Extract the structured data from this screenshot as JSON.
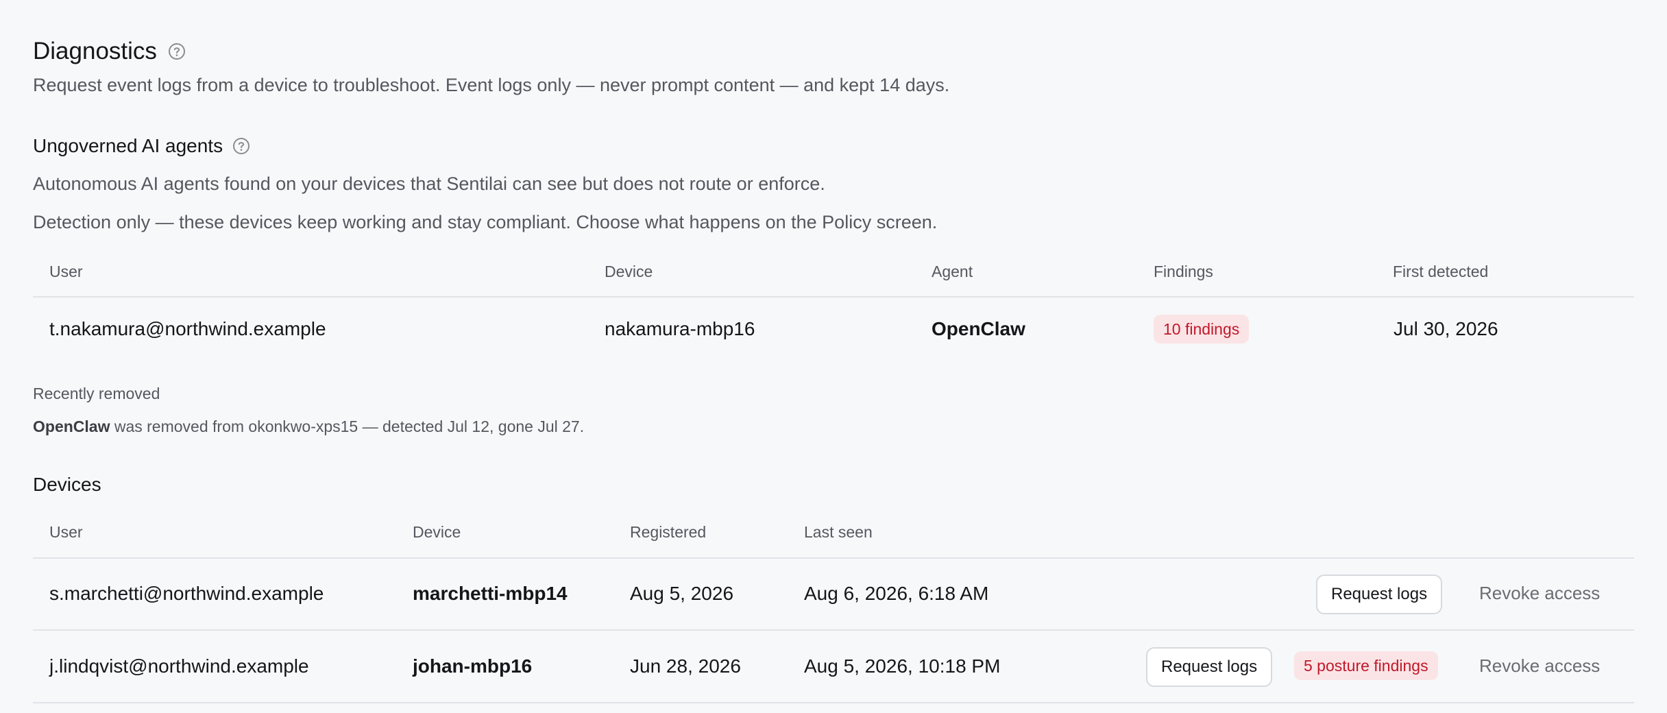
{
  "diagnostics": {
    "title": "Diagnostics",
    "subtitle": "Request event logs from a device to troubleshoot. Event logs only — never prompt content — and kept 14 days."
  },
  "ungoverned": {
    "title": "Ungoverned AI agents",
    "description1": "Autonomous AI agents found on your devices that Sentilai can see but does not route or enforce.",
    "description2": "Detection only — these devices keep working and stay compliant. Choose what happens on the Policy screen.",
    "columns": {
      "user": "User",
      "device": "Device",
      "agent": "Agent",
      "findings": "Findings",
      "first_detected": "First detected"
    },
    "rows": [
      {
        "user": "t.nakamura@northwind.example",
        "device": "nakamura-mbp16",
        "agent": "OpenClaw",
        "findings": "10 findings",
        "first_detected": "Jul 30, 2026"
      }
    ],
    "recently_removed": {
      "label": "Recently removed",
      "agent": "OpenClaw",
      "text": " was removed from okonkwo-xps15 — detected Jul 12, gone Jul 27."
    }
  },
  "devices": {
    "title": "Devices",
    "columns": {
      "user": "User",
      "device": "Device",
      "registered": "Registered",
      "last_seen": "Last seen"
    },
    "rows": [
      {
        "user": "s.marchetti@northwind.example",
        "device": "marchetti-mbp14",
        "registered": "Aug 5, 2026",
        "last_seen": "Aug 6, 2026, 6:18 AM",
        "request_logs": "Request logs",
        "revoke": "Revoke access"
      },
      {
        "user": "j.lindqvist@northwind.example",
        "device": "johan-mbp16",
        "registered": "Jun 28, 2026",
        "last_seen": "Aug 5, 2026, 10:18 PM",
        "request_logs": "Request logs",
        "posture_findings": "5 posture findings",
        "revoke": "Revoke access"
      }
    ]
  },
  "icons": {
    "help": "help-circle-icon"
  },
  "colors": {
    "background": "#f7f8fa",
    "danger_text": "#c0182a",
    "danger_bg": "#fbe4e6",
    "muted_text": "#55575e",
    "divider": "#e1e3e8"
  }
}
